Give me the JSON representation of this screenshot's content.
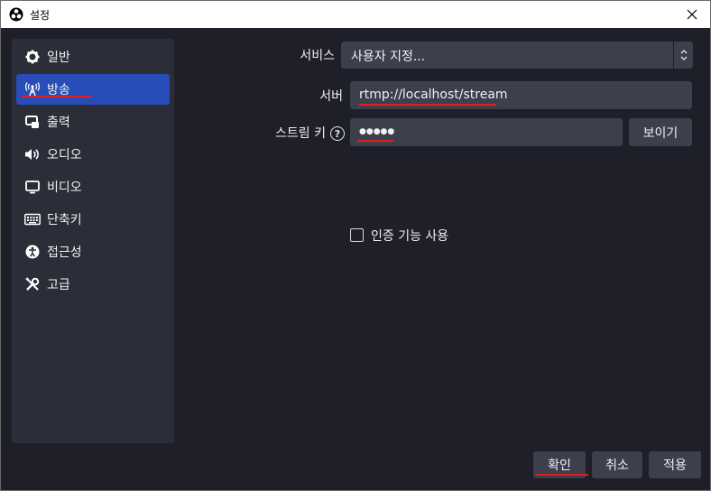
{
  "window": {
    "title": "설정"
  },
  "sidebar": {
    "items": [
      {
        "label": "일반",
        "icon": "gear-icon"
      },
      {
        "label": "방송",
        "icon": "antenna-icon"
      },
      {
        "label": "출력",
        "icon": "output-icon"
      },
      {
        "label": "오디오",
        "icon": "speaker-icon"
      },
      {
        "label": "비디오",
        "icon": "monitor-icon"
      },
      {
        "label": "단축키",
        "icon": "keyboard-icon"
      },
      {
        "label": "접근성",
        "icon": "accessibility-icon"
      },
      {
        "label": "고급",
        "icon": "tools-icon"
      }
    ],
    "active_index": 1
  },
  "stream": {
    "service_label": "서비스",
    "service_value": "사용자 지정...",
    "server_label": "서버",
    "server_value": "rtmp://localhost/stream",
    "key_label": "스트림 키",
    "key_value": "●●●●●",
    "show_button": "보이기",
    "auth_label": "인증 기능 사용",
    "auth_checked": false
  },
  "footer": {
    "ok": "확인",
    "cancel": "취소",
    "apply": "적용"
  },
  "colors": {
    "background": "#1e1f29",
    "panel": "#2b2e38",
    "active": "#284cb8",
    "control": "#3c404d",
    "highlight": "#e02020"
  }
}
